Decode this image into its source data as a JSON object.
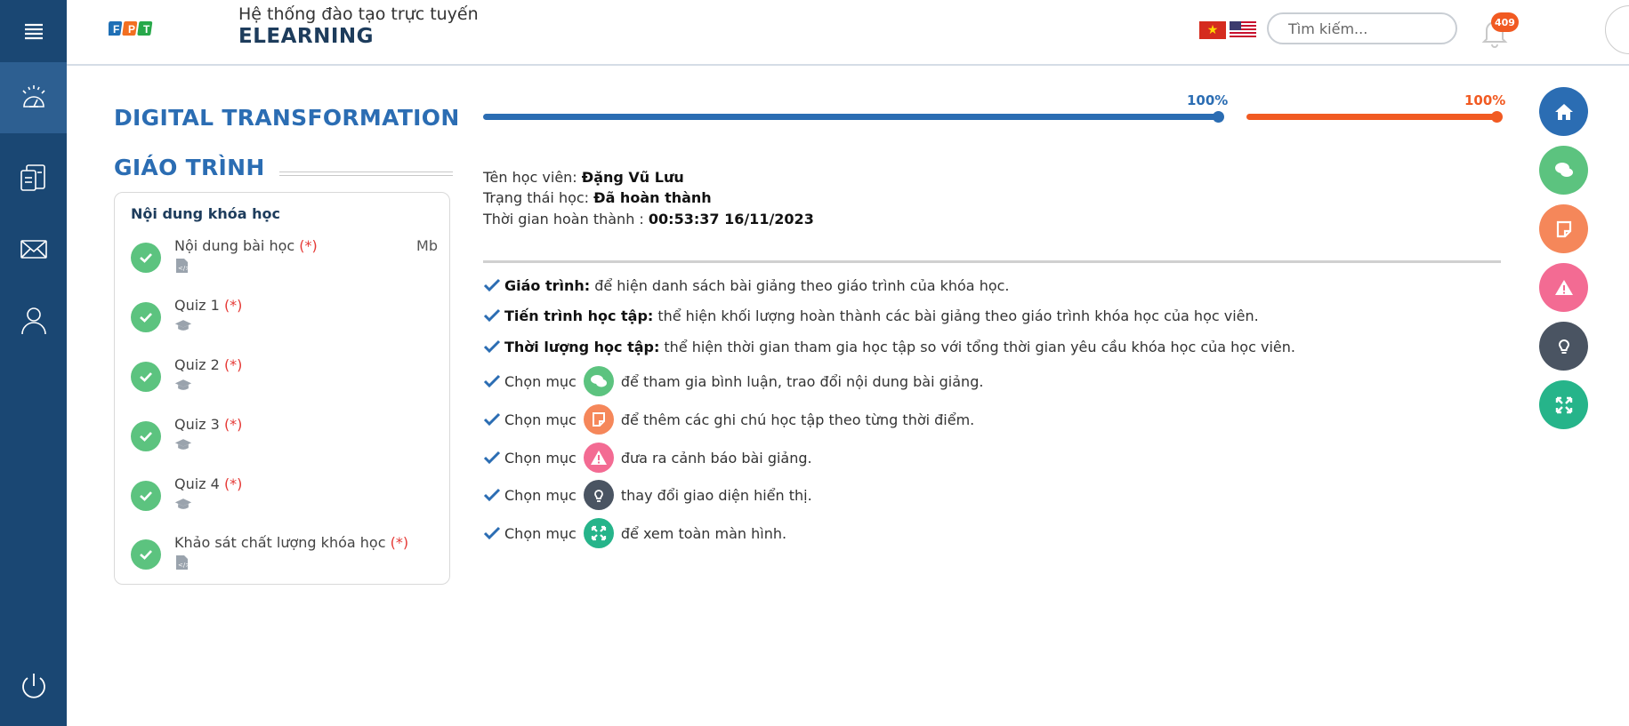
{
  "header": {
    "system_subtitle": "Hệ thống đào tạo trực tuyến",
    "system_title": "ELEARNING",
    "search_placeholder": "Tìm kiếm...",
    "notification_count": "409"
  },
  "sidebar": {
    "items": [
      {
        "icon": "dashboard-icon"
      },
      {
        "icon": "documents-icon"
      },
      {
        "icon": "mail-icon"
      },
      {
        "icon": "user-icon"
      },
      {
        "icon": "power-icon"
      }
    ]
  },
  "course": {
    "title": "DIGITAL TRANSFORMATION",
    "section_title": "GIÁO TRÌNH",
    "content_heading": "Nội dung khóa học",
    "required_mark": "(*)",
    "lessons": [
      {
        "name": "Nội dung bài học",
        "size": "Mb",
        "type": "code-file-icon"
      },
      {
        "name": "Quiz 1",
        "size": "",
        "type": "graduation-cap-icon"
      },
      {
        "name": "Quiz 2",
        "size": "",
        "type": "graduation-cap-icon"
      },
      {
        "name": "Quiz 3",
        "size": "",
        "type": "graduation-cap-icon"
      },
      {
        "name": "Quiz 4",
        "size": "",
        "type": "graduation-cap-icon"
      },
      {
        "name": "Khảo sát chất lượng khóa học",
        "size": "",
        "type": "code-file-icon"
      }
    ]
  },
  "progress": {
    "learning_progress_label": "100%",
    "learning_progress_value": 1.0,
    "learning_progress_color": "#2b6db3",
    "duration_label": "100%",
    "duration_value": 1.0,
    "duration_color": "#f15a22"
  },
  "student": {
    "name_label": "Tên học viên:",
    "name_value": "Đặng Vũ Lưu",
    "status_label": "Trạng thái học:",
    "status_value": "Đã hoàn thành",
    "completed_label": "Thời gian hoàn thành :",
    "completed_value": "00:53:37 16/11/2023"
  },
  "legend": {
    "items": [
      {
        "bold": "Giáo trình:",
        "text": "để hiện danh sách bài giảng theo giáo trình của khóa học."
      },
      {
        "bold": "Tiến trình học tập:",
        "text": "thể hiện khối lượng hoàn thành các bài giảng theo giáo trình khóa học của học viên."
      },
      {
        "bold": "Thời lượng học tập:",
        "text": "thể hiện thời gian tham gia học tập so với tổng thời gian yêu cầu khóa học của học viên."
      }
    ],
    "choose_label": "Chọn mục",
    "icon_items": [
      {
        "icon": "comments-icon",
        "color": "#5cc37f",
        "text": "để tham gia bình luận, trao đổi nội dung bài giảng."
      },
      {
        "icon": "note-icon",
        "color": "#f5875a",
        "text": "để thêm các ghi chú học tập theo từng thời điểm."
      },
      {
        "icon": "warning-icon",
        "color": "#f36b93",
        "text": "đưa ra cảnh báo bài giảng."
      },
      {
        "icon": "lightbulb-icon",
        "color": "#4a5462",
        "text": "thay đổi giao diện hiển thị."
      },
      {
        "icon": "fullscreen-icon",
        "color": "#26b48a",
        "text": "để xem toàn màn hình."
      }
    ]
  },
  "fabs": [
    {
      "icon": "home-icon",
      "color": "#2b6db3"
    },
    {
      "icon": "comments-icon",
      "color": "#5cc37f"
    },
    {
      "icon": "note-icon",
      "color": "#f5875a"
    },
    {
      "icon": "warning-icon",
      "color": "#f36b93"
    },
    {
      "icon": "lightbulb-icon",
      "color": "#4a5462"
    },
    {
      "icon": "fullscreen-icon",
      "color": "#26b48a"
    }
  ]
}
